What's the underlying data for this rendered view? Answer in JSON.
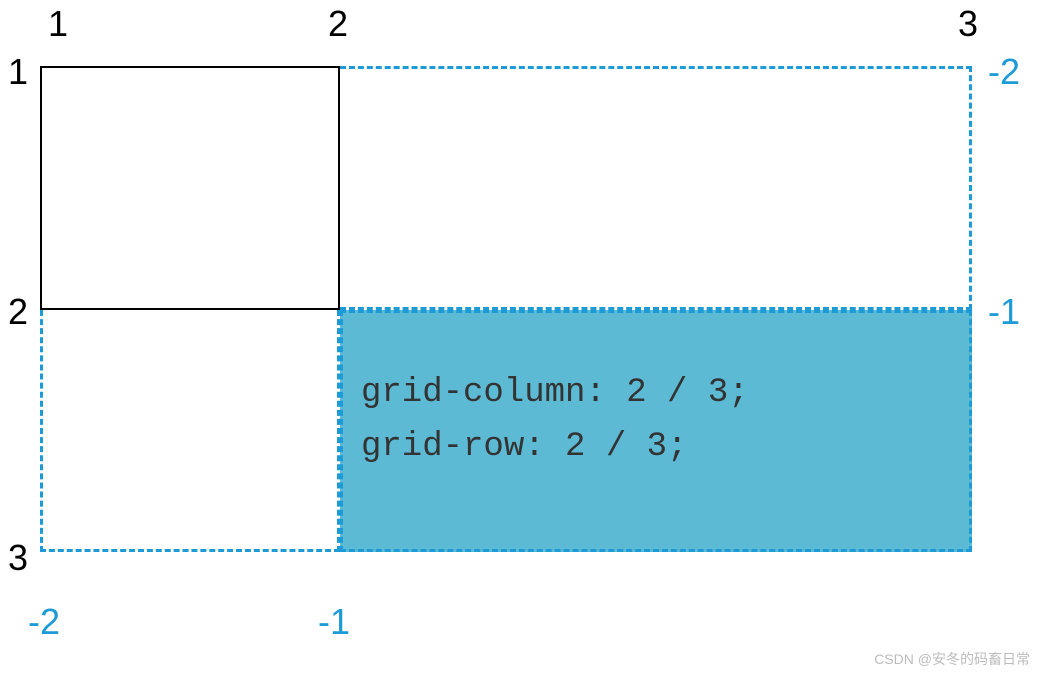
{
  "cols_top": {
    "c1": "1",
    "c2": "2",
    "c3": "3"
  },
  "rows_left": {
    "r1": "1",
    "r2": "2",
    "r3": "3"
  },
  "cols_bottom_neg": {
    "n2": "-2",
    "n1": "-1"
  },
  "rows_right_neg": {
    "n2": "-2",
    "n1": "-1"
  },
  "annotation": {
    "line1": "grid-column: 2 / 3;",
    "line2": "grid-row: 2 / 3;"
  },
  "watermark": "CSDN @安冬的码畜日常",
  "colors": {
    "blue": "#1d9bd6",
    "fill": "#5dbad4"
  }
}
